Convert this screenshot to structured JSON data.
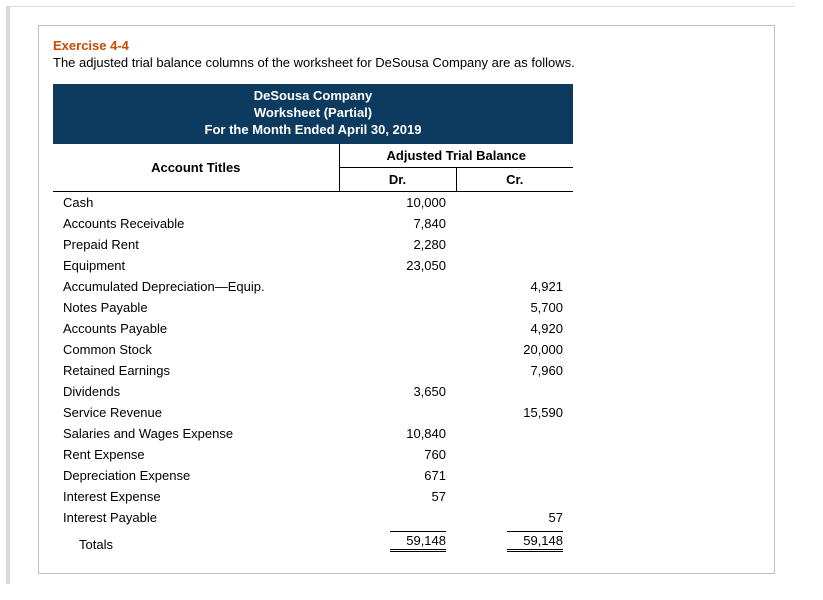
{
  "exercise": {
    "title": "Exercise 4-4",
    "intro": "The adjusted trial balance columns of the worksheet for DeSousa Company are as follows."
  },
  "table_header": {
    "company": "DeSousa Company",
    "subtitle": "Worksheet (Partial)",
    "period": "For the Month Ended April 30, 2019",
    "atb_label": "Adjusted Trial Balance",
    "acct_label": "Account Titles",
    "dr_label": "Dr.",
    "cr_label": "Cr."
  },
  "rows": [
    {
      "account": "Cash",
      "dr": "10,000",
      "cr": ""
    },
    {
      "account": "Accounts Receivable",
      "dr": "7,840",
      "cr": ""
    },
    {
      "account": "Prepaid Rent",
      "dr": "2,280",
      "cr": ""
    },
    {
      "account": "Equipment",
      "dr": "23,050",
      "cr": ""
    },
    {
      "account": "Accumulated Depreciation—Equip.",
      "dr": "",
      "cr": "4,921"
    },
    {
      "account": "Notes Payable",
      "dr": "",
      "cr": "5,700"
    },
    {
      "account": "Accounts Payable",
      "dr": "",
      "cr": "4,920"
    },
    {
      "account": "Common Stock",
      "dr": "",
      "cr": "20,000"
    },
    {
      "account": "Retained Earnings",
      "dr": "",
      "cr": "7,960"
    },
    {
      "account": "Dividends",
      "dr": "3,650",
      "cr": ""
    },
    {
      "account": "Service Revenue",
      "dr": "",
      "cr": "15,590"
    },
    {
      "account": "Salaries and Wages Expense",
      "dr": "10,840",
      "cr": ""
    },
    {
      "account": "Rent Expense",
      "dr": "760",
      "cr": ""
    },
    {
      "account": "Depreciation Expense",
      "dr": "671",
      "cr": ""
    },
    {
      "account": "Interest Expense",
      "dr": "57",
      "cr": ""
    },
    {
      "account": "Interest Payable",
      "dr": "",
      "cr": "57"
    }
  ],
  "totals": {
    "label": "Totals",
    "dr": "59,148",
    "cr": "59,148"
  }
}
